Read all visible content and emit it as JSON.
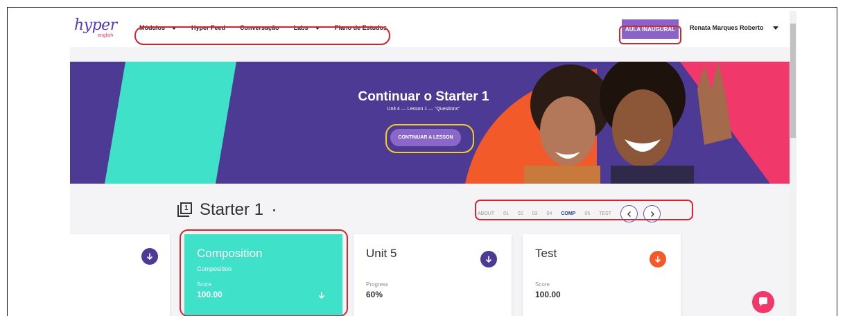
{
  "navbar": {
    "logo": "hyper",
    "logo_sub": "english",
    "items": [
      {
        "label": "Módulos",
        "dropdown": true
      },
      {
        "label": "Hyper Feed",
        "dropdown": false
      },
      {
        "label": "Conversação",
        "dropdown": false
      },
      {
        "label": "Labs",
        "dropdown": true
      },
      {
        "label": "Plano de Estudos",
        "dropdown": false
      }
    ],
    "aula_button": "AULA INAUGURAL",
    "user_name": "Renata Marques Roberto"
  },
  "hero": {
    "title": "Continuar o Starter 1",
    "subtitle": "Unit 4 — Lesson 1 — \"Questions\"",
    "button": "CONTINUAR A LESSON"
  },
  "course": {
    "title": "Starter 1",
    "unit_links": [
      "ABOUT",
      "01",
      "02",
      "03",
      "04",
      "COMP",
      "05",
      "TEST"
    ],
    "active_link": "COMP"
  },
  "cards": {
    "composition": {
      "title": "Composition",
      "subtitle": "Composition",
      "label": "Score",
      "value": "100.00"
    },
    "unit5": {
      "title": "Unit 5",
      "label": "Progress",
      "value": "60%"
    },
    "test": {
      "title": "Test",
      "label": "Score",
      "value": "100.00"
    }
  },
  "colors": {
    "brand_purple": "#4c3a94",
    "teal": "#3fe1c8",
    "accent_orange": "#f25a2a",
    "pink": "#f0386a",
    "annotation_red": "#d8222e",
    "annotation_yellow": "#f2d21b"
  }
}
